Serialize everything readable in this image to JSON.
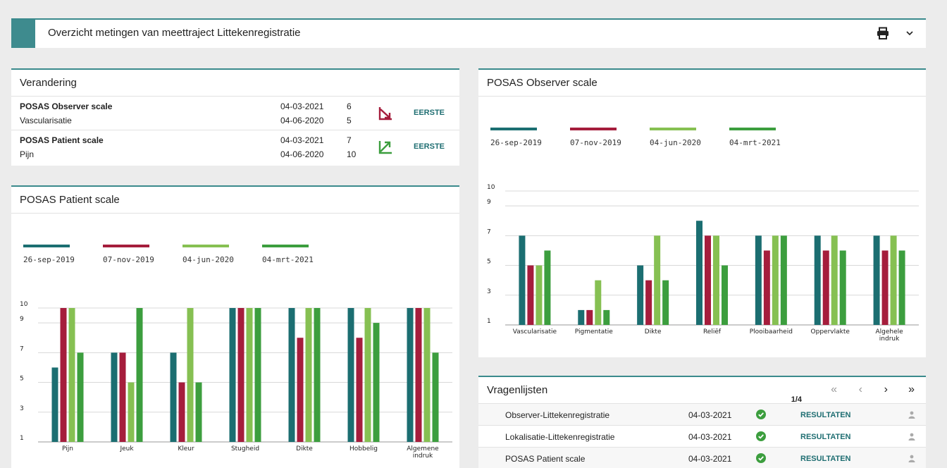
{
  "header": {
    "title": "Overzicht metingen van meettraject Littekenregistratie",
    "print_icon": "printer-icon",
    "expand_icon": "chevron-down-icon"
  },
  "colors": {
    "accent": "#3e8b8e",
    "series": [
      "#1b6e71",
      "#a51d3c",
      "#86c052",
      "#3c9e3e"
    ],
    "trend_down": "#a51d3c",
    "trend_up": "#3c9e3e",
    "link": "#1f6e72"
  },
  "verandering": {
    "title": "Verandering",
    "rows": [
      {
        "name": "POSAS Observer scale",
        "sub": "Vascularisatie",
        "date1": "04-03-2021",
        "val1": "6",
        "date2": "04-06-2020",
        "val2": "5",
        "trend": "trend-down-icon",
        "link": "EERSTE"
      },
      {
        "name": "POSAS Patient scale",
        "sub": "Pijn",
        "date1": "04-03-2021",
        "val1": "7",
        "date2": "04-06-2020",
        "val2": "10",
        "trend": "trend-up-icon",
        "link": "EERSTE"
      }
    ]
  },
  "patient": {
    "title": "POSAS Patient scale"
  },
  "observer": {
    "title": "POSAS Observer scale"
  },
  "chart_data": [
    {
      "type": "bar",
      "title": "POSAS Patient scale",
      "categories": [
        "Pijn",
        "Jeuk",
        "Kleur",
        "Stugheid",
        "Dikte",
        "Hobbelig",
        "Algemene indruk"
      ],
      "yticks": [
        1,
        3,
        5,
        7,
        9,
        10
      ],
      "ylim": [
        1,
        10
      ],
      "grid": true,
      "legend": "top-left",
      "series": [
        {
          "name": "26-sep-2019",
          "values": [
            6,
            7,
            7,
            10,
            10,
            10,
            10
          ]
        },
        {
          "name": "07-nov-2019",
          "values": [
            10,
            7,
            5,
            10,
            8,
            8,
            10
          ]
        },
        {
          "name": "04-jun-2020",
          "values": [
            10,
            5,
            10,
            10,
            10,
            10,
            10
          ]
        },
        {
          "name": "04-mrt-2021",
          "values": [
            7,
            10,
            5,
            10,
            10,
            9,
            7
          ]
        }
      ]
    },
    {
      "type": "bar",
      "title": "POSAS Observer scale",
      "categories": [
        "Vascularisatie",
        "Pigmentatie",
        "Dikte",
        "Reliëf",
        "Plooibaarheid",
        "Oppervlakte",
        "Algehele indruk"
      ],
      "yticks": [
        1,
        3,
        5,
        7,
        9,
        10
      ],
      "ylim": [
        1,
        10
      ],
      "grid": true,
      "legend": "top-left",
      "series": [
        {
          "name": "26-sep-2019",
          "values": [
            7,
            2,
            5,
            8,
            7,
            7,
            7
          ]
        },
        {
          "name": "07-nov-2019",
          "values": [
            5,
            2,
            4,
            7,
            6,
            6,
            6
          ]
        },
        {
          "name": "04-jun-2020",
          "values": [
            5,
            4,
            7,
            7,
            7,
            7,
            7
          ]
        },
        {
          "name": "04-mrt-2021",
          "values": [
            6,
            2,
            4,
            5,
            7,
            6,
            6
          ]
        }
      ]
    }
  ],
  "vragenlijsten": {
    "title": "Vragenlijsten",
    "page": "1/4",
    "nav": {
      "first": "«",
      "prev": "‹",
      "next": "›",
      "last": "»"
    },
    "rows": [
      {
        "name": "Observer-Littekenregistratie",
        "date": "04-03-2021",
        "status_icon": "check-circle-icon",
        "link": "RESULTATEN",
        "user_icon": "user-icon"
      },
      {
        "name": "Lokalisatie-Littekenregistratie",
        "date": "04-03-2021",
        "status_icon": "check-circle-icon",
        "link": "RESULTATEN",
        "user_icon": "user-icon"
      },
      {
        "name": "POSAS Patient scale",
        "date": "04-03-2021",
        "status_icon": "check-circle-icon",
        "link": "RESULTATEN",
        "user_icon": "user-icon"
      }
    ]
  }
}
